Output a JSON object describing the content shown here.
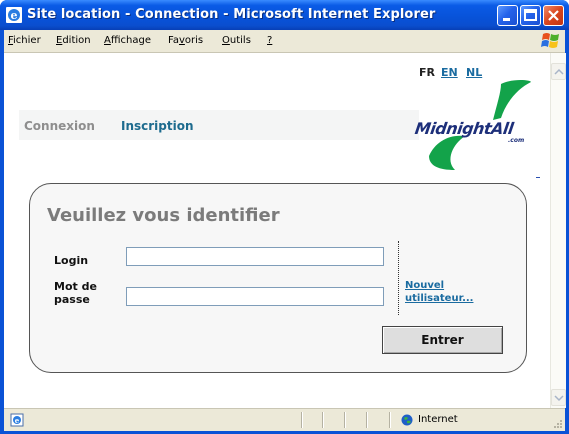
{
  "window": {
    "title": "Site location - Connection - Microsoft Internet Explorer",
    "buttons": {
      "minimize": "minimize",
      "maximize": "maximize",
      "close": "close"
    }
  },
  "menu": {
    "items": [
      {
        "label": "Fichier",
        "accel": "F"
      },
      {
        "label": "Edition",
        "accel": "E"
      },
      {
        "label": "Affichage",
        "accel": "A"
      },
      {
        "label": "Favoris",
        "accel": "v"
      },
      {
        "label": "Outils",
        "accel": "O"
      },
      {
        "label": "?",
        "accel": "?"
      }
    ]
  },
  "page": {
    "languages": {
      "fr": "FR",
      "en": "EN",
      "nl": "NL"
    },
    "nav": {
      "connexion": "Connexion",
      "inscription": "Inscription"
    },
    "logo": {
      "text": "MidnightAll",
      "suffix": ".com"
    },
    "login": {
      "title": "Veuillez vous identifier",
      "login_label": "Login",
      "password_label": "Mot de passe",
      "login_value": "",
      "password_value": "",
      "new_user_link": "Nouvel utilisateur...",
      "submit_label": "Entrer"
    }
  },
  "status": {
    "zone": "Internet"
  },
  "colors": {
    "link": "#1a6ba0",
    "inactive_nav": "#8e8e8e",
    "logo_green": "#13a34a",
    "titlebar": "#0a52d6"
  }
}
